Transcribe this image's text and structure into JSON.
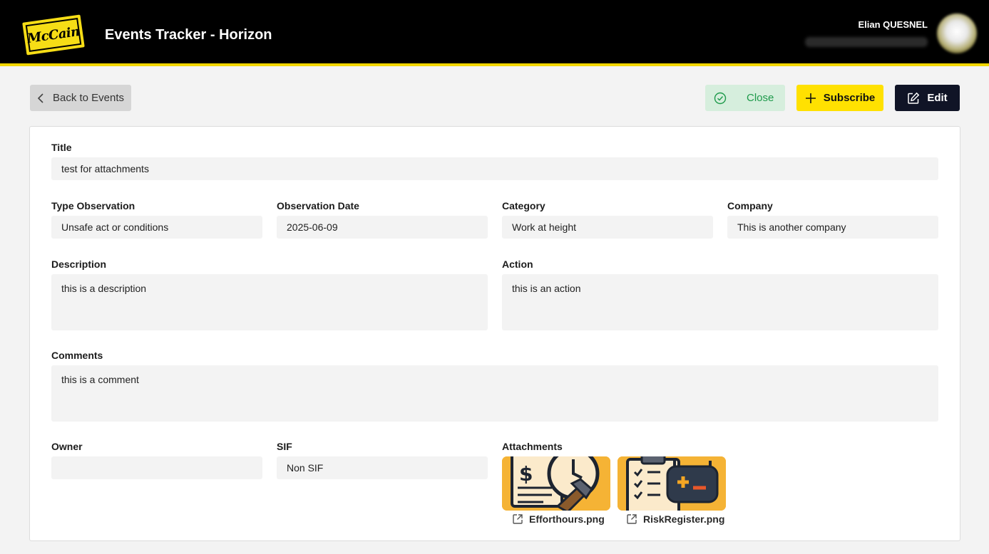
{
  "header": {
    "app_title": "Events Tracker - Horizon",
    "logo_text": "McCain",
    "user_name": "Elian QUESNEL"
  },
  "actions": {
    "back_label": "Back to Events",
    "close_label": "Close",
    "subscribe_label": "Subscribe",
    "edit_label": "Edit"
  },
  "fields": {
    "title": {
      "label": "Title",
      "value": "test for attachments"
    },
    "type_observation": {
      "label": "Type Observation",
      "value": "Unsafe act or conditions"
    },
    "observation_date": {
      "label": "Observation Date",
      "value": "2025-06-09"
    },
    "category": {
      "label": "Category",
      "value": "Work at height"
    },
    "company": {
      "label": "Company",
      "value": "This is another company"
    },
    "description": {
      "label": "Description",
      "value": "this is a description"
    },
    "action": {
      "label": "Action",
      "value": "this is an action"
    },
    "comments": {
      "label": "Comments",
      "value": "this is a comment"
    },
    "owner": {
      "label": "Owner",
      "value": ""
    },
    "sif": {
      "label": "SIF",
      "value": "Non SIF"
    }
  },
  "attachments": {
    "label": "Attachments",
    "items": [
      {
        "name": "Efforthours.png"
      },
      {
        "name": "RiskRegister.png"
      }
    ]
  },
  "colors": {
    "brand_yellow": "#ffe101",
    "header_bg": "#000000",
    "close_bg": "#d6eedd",
    "close_text": "#1e9a4b",
    "edit_bg": "#101426"
  }
}
